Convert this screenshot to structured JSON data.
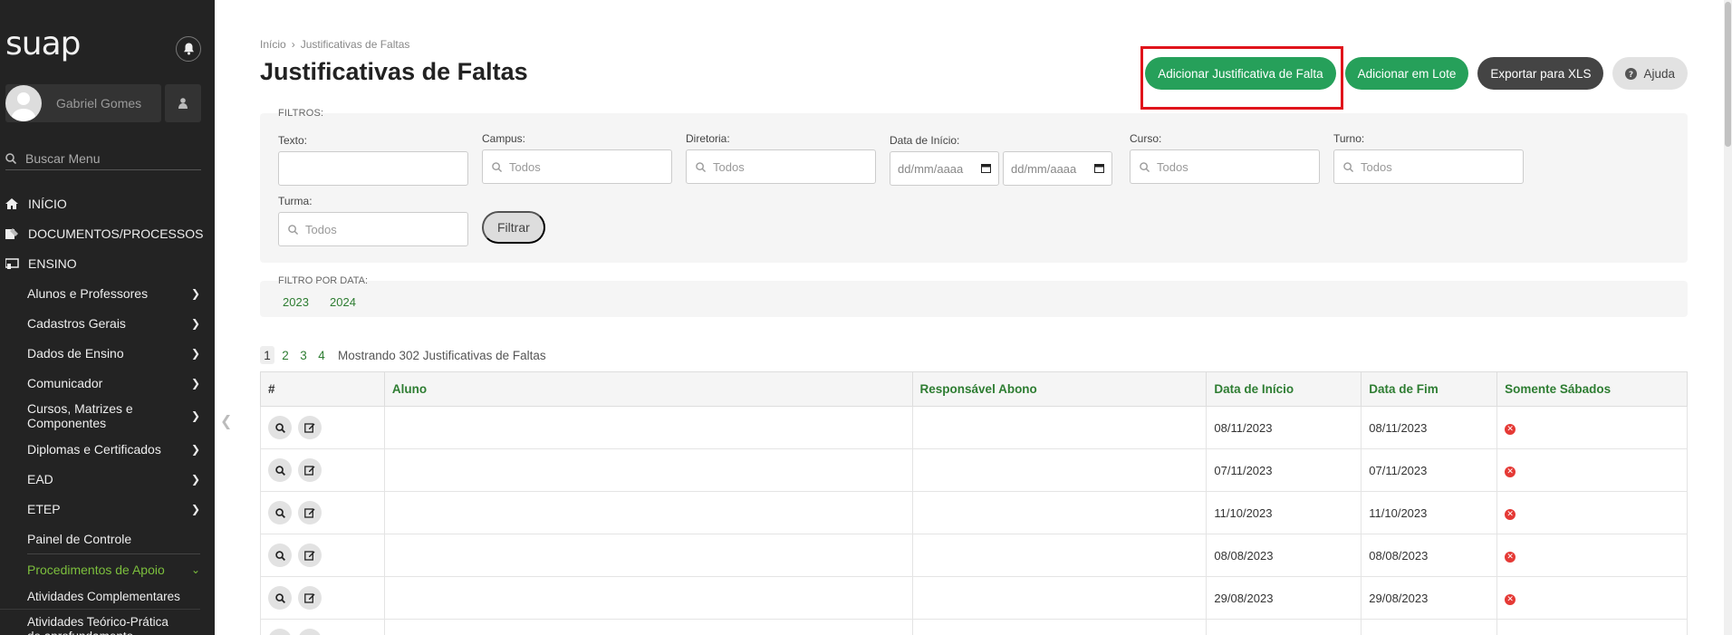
{
  "sidebar": {
    "logo": "suap",
    "user_name": "Gabriel Gomes",
    "search_placeholder": "Buscar Menu",
    "top_items": [
      {
        "label": "INÍCIO",
        "icon": "home-icon"
      },
      {
        "label": "DOCUMENTOS/PROCESSOS",
        "icon": "document-icon"
      },
      {
        "label": "ENSINO",
        "icon": "teaching-icon"
      }
    ],
    "ensino_items": [
      {
        "label": "Alunos e Professores"
      },
      {
        "label": "Cadastros Gerais"
      },
      {
        "label": "Dados de Ensino"
      },
      {
        "label": "Comunicador"
      },
      {
        "label": "Cursos, Matrizes e Componentes"
      },
      {
        "label": "Diplomas e Certificados"
      },
      {
        "label": "EAD"
      },
      {
        "label": "ETEP"
      },
      {
        "label": "Painel de Controle"
      },
      {
        "label": "Procedimentos de Apoio"
      }
    ],
    "apoio_items": [
      {
        "label": "Atividades Complementares"
      },
      {
        "label": "Atividades Teórico-Prática de aprofundamento"
      }
    ]
  },
  "breadcrumb": {
    "home": "Início",
    "current": "Justificativas de Faltas"
  },
  "page_title": "Justificativas de Faltas",
  "actions": {
    "add": "Adicionar Justificativa de Falta",
    "add_batch": "Adicionar em Lote",
    "export": "Exportar para XLS",
    "help": "Ajuda"
  },
  "filters": {
    "section_label": "FILTROS:",
    "texto_label": "Texto:",
    "campus_label": "Campus:",
    "diretoria_label": "Diretoria:",
    "data_inicio_label": "Data de Início:",
    "curso_label": "Curso:",
    "turno_label": "Turno:",
    "turma_label": "Turma:",
    "select_placeholder": "Todos",
    "date_placeholder": "dd/mm/aaaa",
    "filter_button": "Filtrar"
  },
  "date_filter": {
    "label": "FILTRO POR DATA:",
    "years": [
      "2023",
      "2024"
    ]
  },
  "pagination": {
    "pages": [
      "1",
      "2",
      "3",
      "4"
    ],
    "summary": "Mostrando 302 Justificativas de Faltas"
  },
  "table": {
    "headers": [
      "#",
      "Aluno",
      "Responsável Abono",
      "Data de Início",
      "Data de Fim",
      "Somente Sábados"
    ],
    "rows": [
      {
        "inicio": "08/11/2023",
        "fim": "08/11/2023"
      },
      {
        "inicio": "07/11/2023",
        "fim": "07/11/2023"
      },
      {
        "inicio": "11/10/2023",
        "fim": "11/10/2023"
      },
      {
        "inicio": "08/08/2023",
        "fim": "08/08/2023"
      },
      {
        "inicio": "29/08/2023",
        "fim": "29/08/2023"
      }
    ]
  },
  "colors": {
    "green": "#26a05a",
    "link_green": "#2e7d32",
    "sidebar_bg": "#232323",
    "highlight": "#e0141b",
    "status_red": "#e53935"
  }
}
